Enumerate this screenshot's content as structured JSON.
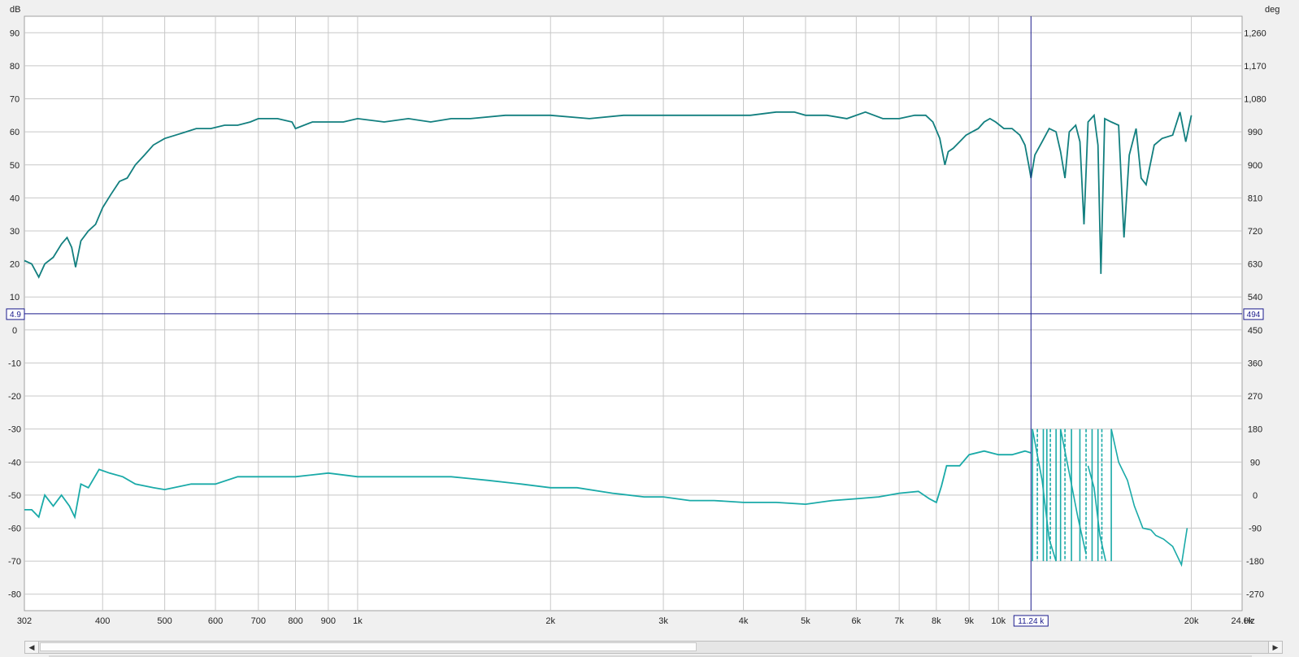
{
  "chart_data": {
    "type": "line",
    "left_axis_unit": "dB",
    "right_axis_unit": "deg",
    "x_axis_unit": "Hz",
    "x_scale": "log",
    "xlim": [
      302,
      24000
    ],
    "ylim_left": [
      -85,
      95
    ],
    "ylim_right": [
      -315,
      1305
    ],
    "x_tick_labels": [
      {
        "value": 302,
        "label": "302"
      },
      {
        "value": 400,
        "label": "400"
      },
      {
        "value": 500,
        "label": "500"
      },
      {
        "value": 600,
        "label": "600"
      },
      {
        "value": 700,
        "label": "700"
      },
      {
        "value": 800,
        "label": "800"
      },
      {
        "value": 900,
        "label": "900"
      },
      {
        "value": 1000,
        "label": "1k"
      },
      {
        "value": 2000,
        "label": "2k"
      },
      {
        "value": 3000,
        "label": "3k"
      },
      {
        "value": 4000,
        "label": "4k"
      },
      {
        "value": 5000,
        "label": "5k"
      },
      {
        "value": 6000,
        "label": "6k"
      },
      {
        "value": 7000,
        "label": "7k"
      },
      {
        "value": 8000,
        "label": "8k"
      },
      {
        "value": 9000,
        "label": "9k"
      },
      {
        "value": 10000,
        "label": "10k"
      },
      {
        "value": 20000,
        "label": "20k"
      },
      {
        "value": 24000,
        "label": "24.0k"
      }
    ],
    "left_ticks": [
      {
        "value": 90,
        "label": "90"
      },
      {
        "value": 80,
        "label": "80"
      },
      {
        "value": 70,
        "label": "70"
      },
      {
        "value": 60,
        "label": "60"
      },
      {
        "value": 50,
        "label": "50"
      },
      {
        "value": 40,
        "label": "40"
      },
      {
        "value": 30,
        "label": "30"
      },
      {
        "value": 20,
        "label": "20"
      },
      {
        "value": 10,
        "label": "10"
      },
      {
        "value": 0,
        "label": "0"
      },
      {
        "value": -10,
        "label": "-10"
      },
      {
        "value": -20,
        "label": "-20"
      },
      {
        "value": -30,
        "label": "-30"
      },
      {
        "value": -40,
        "label": "-40"
      },
      {
        "value": -50,
        "label": "-50"
      },
      {
        "value": -60,
        "label": "-60"
      },
      {
        "value": -70,
        "label": "-70"
      },
      {
        "value": -80,
        "label": "-80"
      }
    ],
    "right_ticks": [
      {
        "value": 1260,
        "label": "1,260"
      },
      {
        "value": 1170,
        "label": "1,170"
      },
      {
        "value": 1080,
        "label": "1,080"
      },
      {
        "value": 990,
        "label": "990"
      },
      {
        "value": 900,
        "label": "900"
      },
      {
        "value": 810,
        "label": "810"
      },
      {
        "value": 720,
        "label": "720"
      },
      {
        "value": 630,
        "label": "630"
      },
      {
        "value": 540,
        "label": "540"
      },
      {
        "value": 450,
        "label": "450"
      },
      {
        "value": 360,
        "label": "360"
      },
      {
        "value": 270,
        "label": "270"
      },
      {
        "value": 180,
        "label": "180"
      },
      {
        "value": 90,
        "label": "90"
      },
      {
        "value": 0,
        "label": "0"
      },
      {
        "value": -90,
        "label": "-90"
      },
      {
        "value": -180,
        "label": "-180"
      },
      {
        "value": -270,
        "label": "-270"
      }
    ],
    "cursor": {
      "freq": 11240,
      "freq_label": "11.24 k",
      "db": 4.9,
      "db_label": "4.9",
      "deg_label": "494"
    },
    "grid": true,
    "colors": {
      "magnitude": "#127f7f",
      "phase": "#1aaaa8",
      "cursor": "#1a1a8c",
      "grid": "#c8c8c8",
      "plot_bg": "#ffffff",
      "frame_bg": "#f0f0f0"
    },
    "series": [
      {
        "id": "magnitude",
        "axis": "left",
        "points": [
          [
            302,
            21
          ],
          [
            310,
            20
          ],
          [
            318,
            16
          ],
          [
            325,
            20
          ],
          [
            335,
            22
          ],
          [
            345,
            26
          ],
          [
            352,
            28
          ],
          [
            358,
            25
          ],
          [
            363,
            19
          ],
          [
            370,
            27
          ],
          [
            380,
            30
          ],
          [
            390,
            32
          ],
          [
            400,
            37
          ],
          [
            412,
            41
          ],
          [
            425,
            45
          ],
          [
            437,
            46
          ],
          [
            450,
            50
          ],
          [
            465,
            53
          ],
          [
            480,
            56
          ],
          [
            500,
            58
          ],
          [
            520,
            59
          ],
          [
            540,
            60
          ],
          [
            560,
            61
          ],
          [
            590,
            61
          ],
          [
            620,
            62
          ],
          [
            650,
            62
          ],
          [
            680,
            63
          ],
          [
            700,
            64
          ],
          [
            750,
            64
          ],
          [
            790,
            63
          ],
          [
            800,
            61
          ],
          [
            850,
            63
          ],
          [
            900,
            63
          ],
          [
            950,
            63
          ],
          [
            1000,
            64
          ],
          [
            1100,
            63
          ],
          [
            1200,
            64
          ],
          [
            1300,
            63
          ],
          [
            1400,
            64
          ],
          [
            1500,
            64
          ],
          [
            1700,
            65
          ],
          [
            1900,
            65
          ],
          [
            2000,
            65
          ],
          [
            2300,
            64
          ],
          [
            2600,
            65
          ],
          [
            2900,
            65
          ],
          [
            3200,
            65
          ],
          [
            3500,
            65
          ],
          [
            3800,
            65
          ],
          [
            4100,
            65
          ],
          [
            4500,
            66
          ],
          [
            4800,
            66
          ],
          [
            5000,
            65
          ],
          [
            5400,
            65
          ],
          [
            5800,
            64
          ],
          [
            6200,
            66
          ],
          [
            6600,
            64
          ],
          [
            7000,
            64
          ],
          [
            7400,
            65
          ],
          [
            7700,
            65
          ],
          [
            7900,
            63
          ],
          [
            8100,
            58
          ],
          [
            8250,
            50
          ],
          [
            8350,
            54
          ],
          [
            8500,
            55
          ],
          [
            8700,
            57
          ],
          [
            8900,
            59
          ],
          [
            9100,
            60
          ],
          [
            9300,
            61
          ],
          [
            9500,
            63
          ],
          [
            9700,
            64
          ],
          [
            9900,
            63
          ],
          [
            10200,
            61
          ],
          [
            10500,
            61
          ],
          [
            10800,
            59
          ],
          [
            11000,
            56
          ],
          [
            11150,
            50
          ],
          [
            11240,
            46
          ],
          [
            11400,
            53
          ],
          [
            11700,
            57
          ],
          [
            12000,
            61
          ],
          [
            12300,
            60
          ],
          [
            12500,
            54
          ],
          [
            12700,
            46
          ],
          [
            12900,
            60
          ],
          [
            13200,
            62
          ],
          [
            13400,
            57
          ],
          [
            13600,
            32
          ],
          [
            13800,
            63
          ],
          [
            14100,
            65
          ],
          [
            14300,
            56
          ],
          [
            14450,
            17
          ],
          [
            14650,
            64
          ],
          [
            15000,
            63
          ],
          [
            15400,
            62
          ],
          [
            15700,
            28
          ],
          [
            16000,
            53
          ],
          [
            16400,
            61
          ],
          [
            16700,
            46
          ],
          [
            17000,
            44
          ],
          [
            17500,
            56
          ],
          [
            18000,
            58
          ],
          [
            18700,
            59
          ],
          [
            19200,
            66
          ],
          [
            19600,
            57
          ],
          [
            20000,
            65
          ]
        ]
      },
      {
        "id": "phase",
        "axis": "right",
        "points": [
          [
            302,
            -40
          ],
          [
            310,
            -40
          ],
          [
            318,
            -60
          ],
          [
            325,
            0
          ],
          [
            335,
            -30
          ],
          [
            345,
            0
          ],
          [
            355,
            -30
          ],
          [
            362,
            -60
          ],
          [
            370,
            30
          ],
          [
            380,
            20
          ],
          [
            395,
            70
          ],
          [
            410,
            60
          ],
          [
            430,
            50
          ],
          [
            450,
            30
          ],
          [
            480,
            20
          ],
          [
            500,
            15
          ],
          [
            550,
            30
          ],
          [
            600,
            30
          ],
          [
            650,
            50
          ],
          [
            700,
            50
          ],
          [
            750,
            50
          ],
          [
            800,
            50
          ],
          [
            900,
            60
          ],
          [
            1000,
            50
          ],
          [
            1100,
            50
          ],
          [
            1200,
            50
          ],
          [
            1300,
            50
          ],
          [
            1400,
            50
          ],
          [
            1500,
            45
          ],
          [
            1600,
            40
          ],
          [
            1800,
            30
          ],
          [
            2000,
            20
          ],
          [
            2200,
            20
          ],
          [
            2500,
            5
          ],
          [
            2800,
            -5
          ],
          [
            3000,
            -5
          ],
          [
            3300,
            -15
          ],
          [
            3600,
            -15
          ],
          [
            4000,
            -20
          ],
          [
            4500,
            -20
          ],
          [
            5000,
            -25
          ],
          [
            5500,
            -15
          ],
          [
            6000,
            -10
          ],
          [
            6500,
            -5
          ],
          [
            7000,
            5
          ],
          [
            7500,
            10
          ],
          [
            7800,
            -10
          ],
          [
            8000,
            -20
          ],
          [
            8150,
            25
          ],
          [
            8300,
            80
          ],
          [
            8700,
            80
          ],
          [
            9000,
            110
          ],
          [
            9500,
            120
          ],
          [
            10000,
            110
          ],
          [
            10500,
            110
          ],
          [
            11000,
            120
          ],
          [
            11240,
            115
          ]
        ]
      }
    ]
  }
}
